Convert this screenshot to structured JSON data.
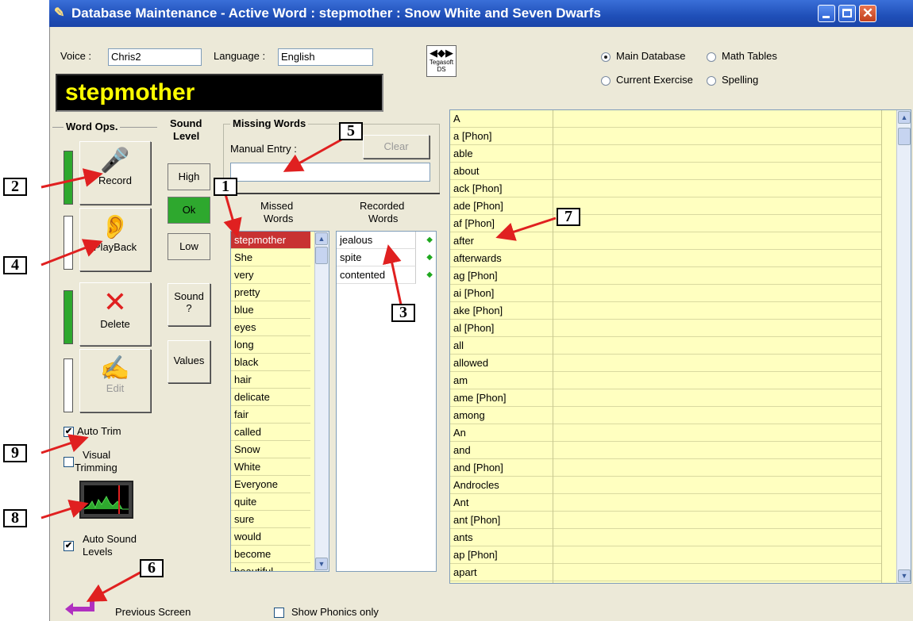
{
  "window": {
    "title": "Database Maintenance  - Active Word : stepmother  : Snow White and Seven Dwarfs"
  },
  "header": {
    "voice_label": "Voice :",
    "voice_value": "Chris2",
    "language_label": "Language :",
    "language_value": "English",
    "logo_text": "Tegasoft DS",
    "active_word": "stepmother"
  },
  "database_options": [
    {
      "label": "Main Database",
      "selected": true
    },
    {
      "label": "Math Tables",
      "selected": false
    },
    {
      "label": "Current Exercise",
      "selected": false
    },
    {
      "label": "Spelling",
      "selected": false
    }
  ],
  "word_ops": {
    "title": "Word Ops.",
    "record": "Record",
    "playback": "PlayBack",
    "delete": "Delete",
    "edit": "Edit"
  },
  "sound_level": {
    "title_line1": "Sound",
    "title_line2": "Level",
    "high": "High",
    "ok": "Ok",
    "low": "Low",
    "sound_q_line1": "Sound",
    "sound_q_line2": "?",
    "values": "Values"
  },
  "missing_words": {
    "title": "Missing Words",
    "manual_entry_label": "Manual Entry :",
    "manual_entry_value": "",
    "clear": "Clear",
    "missed_header_line1": "Missed",
    "missed_header_line2": "Words",
    "recorded_header_line1": "Recorded",
    "recorded_header_line2": "Words",
    "missed": [
      "stepmother",
      "She",
      "very",
      "pretty",
      "blue",
      "eyes",
      "long",
      "black",
      "hair",
      "delicate",
      "fair",
      "called",
      "Snow",
      "White",
      "Everyone",
      "quite",
      "sure",
      "would",
      "become",
      "beautiful"
    ],
    "recorded": [
      "jealous",
      "spite",
      "contented"
    ]
  },
  "options": {
    "auto_trim": "Auto Trim",
    "auto_trim_checked": true,
    "visual_trimming_line1": "Visual",
    "visual_trimming_line2": "Trimming",
    "visual_trimming_checked": false,
    "auto_sound_levels_line1": "Auto Sound",
    "auto_sound_levels_line2": "Levels",
    "auto_sound_levels_checked": true
  },
  "main_list": [
    "A",
    "a [Phon]",
    "able",
    "about",
    "ack [Phon]",
    "ade [Phon]",
    "af [Phon]",
    "after",
    "afterwards",
    "ag [Phon]",
    "ai [Phon]",
    "ake [Phon]",
    "al [Phon]",
    "all",
    "allowed",
    "am",
    "ame [Phon]",
    "among",
    "An",
    "and",
    "and [Phon]",
    "Androcles",
    "Ant",
    "ant [Phon]",
    "ants",
    "ap [Phon]",
    "apart"
  ],
  "footer": {
    "previous_screen": "Previous Screen",
    "show_phonics_only": "Show Phonics only"
  },
  "callouts": [
    "1",
    "2",
    "3",
    "4",
    "5",
    "6",
    "7",
    "8",
    "9"
  ],
  "colors": {
    "accent_green": "#2ea82e",
    "selected_row": "#c83232",
    "list_bg": "#ffffc0",
    "callout_arrow": "#e02020"
  }
}
